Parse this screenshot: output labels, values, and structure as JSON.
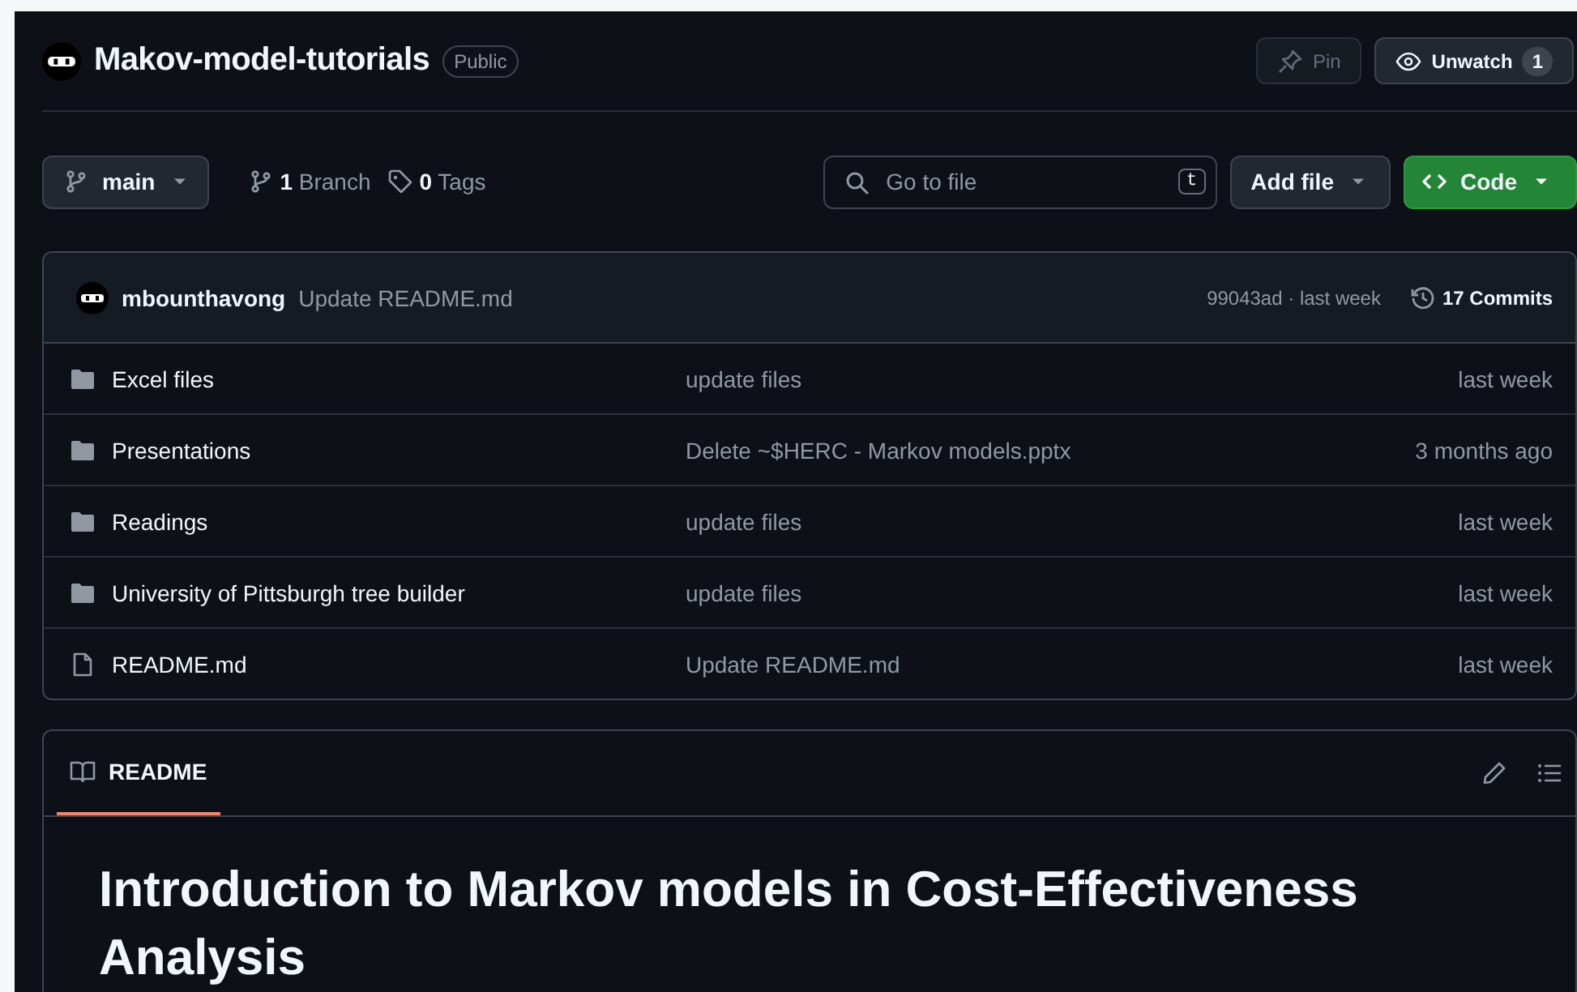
{
  "repo": {
    "name": "Makov-model-tutorials",
    "visibility": "Public"
  },
  "header_actions": [
    {
      "kind": "pin",
      "label": "Pin",
      "disabled": true
    },
    {
      "kind": "watch",
      "label": "Unwatch",
      "count": "1",
      "disabled": false
    }
  ],
  "branch_bar": {
    "branch": "main",
    "branch_count": "1",
    "branch_label": "Branch",
    "tag_count": "0",
    "tag_label": "Tags",
    "search": {
      "placeholder": "Go to file",
      "shortcut": "t"
    },
    "add_file": "Add file",
    "code": "Code"
  },
  "latest_commit": {
    "author": "mbounthavong",
    "message": "Update README.md",
    "hash_time": "99043ad · last week",
    "commits": "17 Commits"
  },
  "files": [
    {
      "kind": "folder",
      "name": "Excel files",
      "message": "update files",
      "time": "last week"
    },
    {
      "kind": "folder",
      "name": "Presentations",
      "message": "Delete ~$HERC - Markov models.pptx",
      "time": "3 months ago"
    },
    {
      "kind": "folder",
      "name": "Readings",
      "message": "update files",
      "time": "last week"
    },
    {
      "kind": "folder",
      "name": "University of Pittsburgh tree builder",
      "message": "update files",
      "time": "last week"
    },
    {
      "kind": "file",
      "name": "README.md",
      "message": "Update README.md",
      "time": "last week"
    }
  ],
  "readme": {
    "tabs": [
      {
        "label": "README",
        "selected": true
      }
    ],
    "heading": "Introduction to Markov models in Cost-Effectiveness Analysis"
  }
}
